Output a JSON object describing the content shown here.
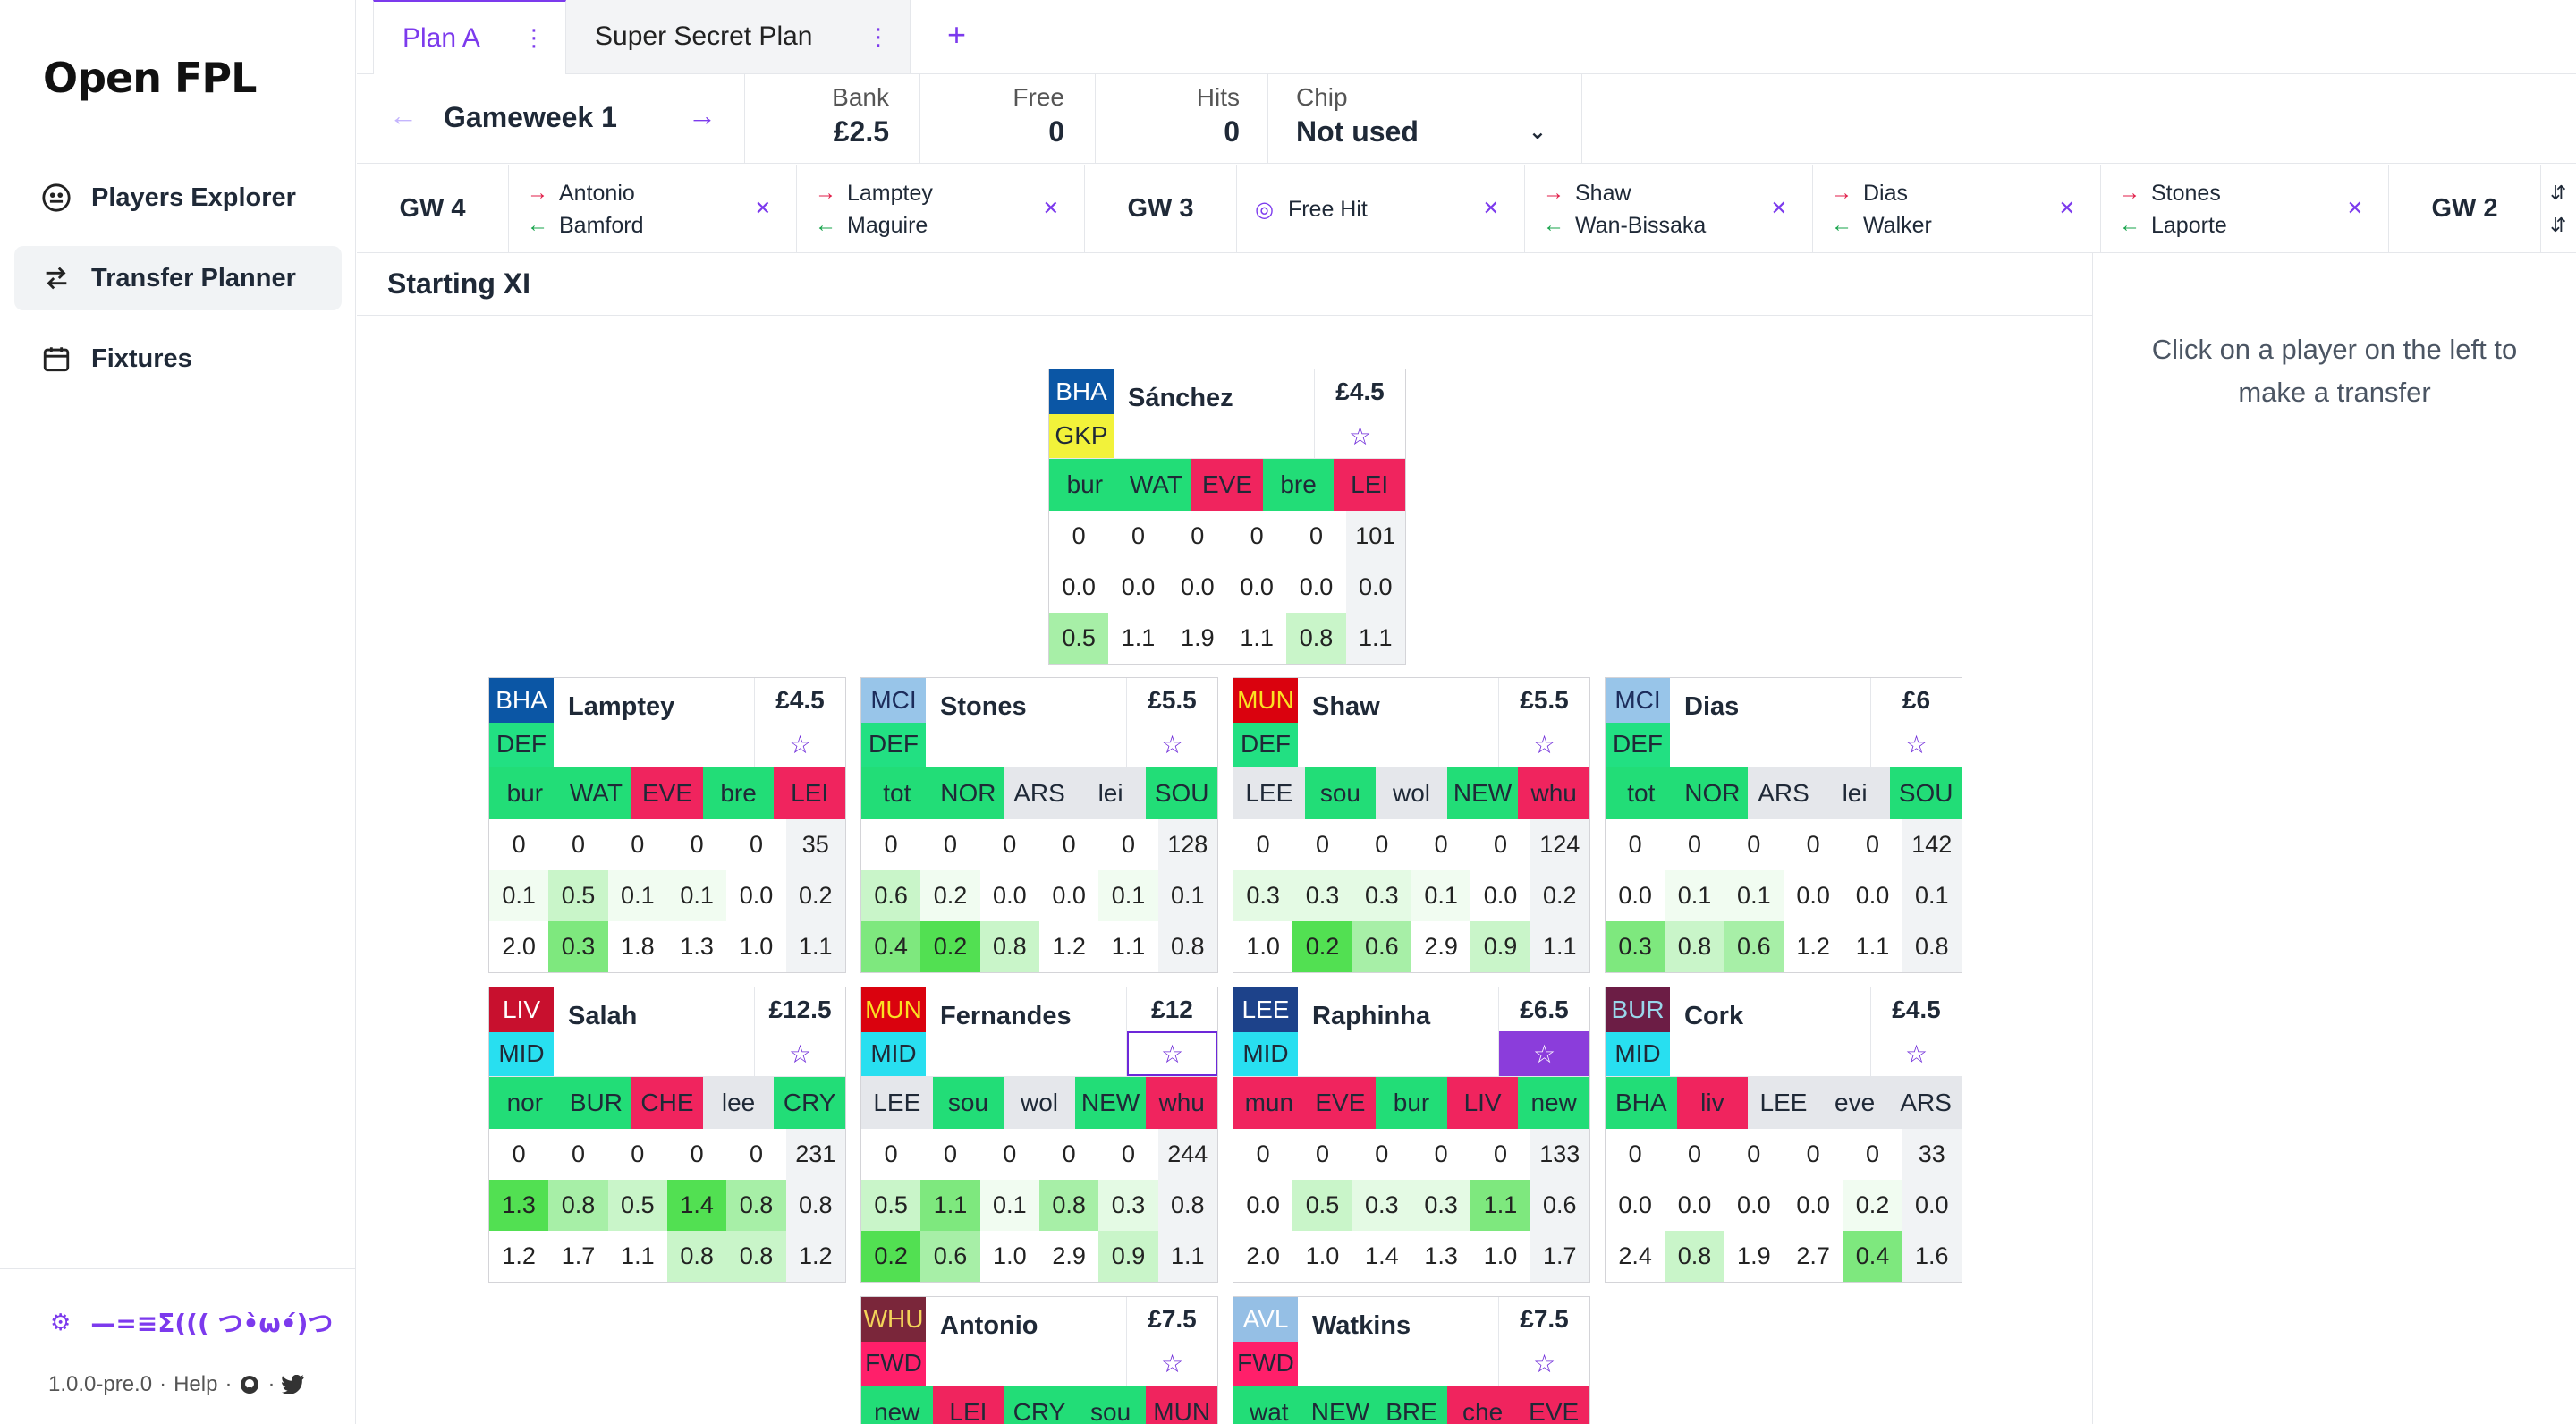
{
  "app": {
    "title": "Open FPL",
    "version": "1.0.0-pre.0",
    "help": "Help",
    "tagline": "—=≡Σ((( つ•̀ω•́)つ"
  },
  "nav": [
    {
      "label": "Players Explorer",
      "icon": "players-icon"
    },
    {
      "label": "Transfer Planner",
      "icon": "transfer-icon"
    },
    {
      "label": "Fixtures",
      "icon": "calendar-icon"
    }
  ],
  "tabs": [
    {
      "label": "Plan A"
    },
    {
      "label": "Super Secret Plan"
    }
  ],
  "stats": {
    "gameweek": "Gameweek 1",
    "bank_label": "Bank",
    "bank": "£2.5",
    "free_label": "Free",
    "free": "0",
    "hits_label": "Hits",
    "hits": "0",
    "chip_label": "Chip",
    "chip": "Not used"
  },
  "chain": {
    "gw4": "GW 4",
    "gw3": "GW 3",
    "gw2": "GW 2",
    "t1": {
      "out": "Antonio",
      "in": "Bamford"
    },
    "t2": {
      "out": "Lamptey",
      "in": "Maguire"
    },
    "freehit": "Free Hit",
    "t3": {
      "out": "Shaw",
      "in": "Wan-Bissaka"
    },
    "t4": {
      "out": "Dias",
      "in": "Walker"
    },
    "t5": {
      "out": "Stones",
      "in": "Laporte"
    }
  },
  "section": "Starting XI",
  "hint": "Click on a player on the left to make a transfer",
  "colors": {
    "accent": "#7c3aed",
    "green": "#22dd77",
    "red": "#f0245e",
    "grey": "#e5e7eb",
    "gkp": "#f2f23a",
    "def": "#22e082",
    "mid": "#28dff0",
    "fwd": "#ff1f6a"
  },
  "players": {
    "sanchez": {
      "team": "BHA",
      "pos": "GKP",
      "name": "Sánchez",
      "price": "£4.5",
      "star": "☆",
      "fix": [
        "bur",
        "WAT",
        "EVE",
        "bre",
        "LEI"
      ],
      "r1": [
        "0",
        "0",
        "0",
        "0",
        "0",
        "101"
      ],
      "r2": [
        "0.0",
        "0.0",
        "0.0",
        "0.0",
        "0.0",
        "0.0"
      ],
      "r3": [
        "0.5",
        "1.1",
        "1.9",
        "1.1",
        "0.8",
        "1.1"
      ]
    },
    "lamptey": {
      "team": "BHA",
      "pos": "DEF",
      "name": "Lamptey",
      "price": "£4.5",
      "star": "☆",
      "fix": [
        "bur",
        "WAT",
        "EVE",
        "bre",
        "LEI"
      ],
      "r1": [
        "0",
        "0",
        "0",
        "0",
        "0",
        "35"
      ],
      "r2": [
        "0.1",
        "0.5",
        "0.1",
        "0.1",
        "0.0",
        "0.2"
      ],
      "r3": [
        "2.0",
        "0.3",
        "1.8",
        "1.3",
        "1.0",
        "1.1"
      ]
    },
    "stones": {
      "team": "MCI",
      "pos": "DEF",
      "name": "Stones",
      "price": "£5.5",
      "star": "☆",
      "fix": [
        "tot",
        "NOR",
        "ARS",
        "lei",
        "SOU"
      ],
      "r1": [
        "0",
        "0",
        "0",
        "0",
        "0",
        "128"
      ],
      "r2": [
        "0.6",
        "0.2",
        "0.0",
        "0.0",
        "0.1",
        "0.1"
      ],
      "r3": [
        "0.4",
        "0.2",
        "0.8",
        "1.2",
        "1.1",
        "0.8"
      ]
    },
    "shaw": {
      "team": "MUN",
      "pos": "DEF",
      "name": "Shaw",
      "price": "£5.5",
      "star": "☆",
      "fix": [
        "LEE",
        "sou",
        "wol",
        "NEW",
        "whu"
      ],
      "r1": [
        "0",
        "0",
        "0",
        "0",
        "0",
        "124"
      ],
      "r2": [
        "0.3",
        "0.3",
        "0.3",
        "0.1",
        "0.0",
        "0.2"
      ],
      "r3": [
        "1.0",
        "0.2",
        "0.6",
        "2.9",
        "0.9",
        "1.1"
      ]
    },
    "dias": {
      "team": "MCI",
      "pos": "DEF",
      "name": "Dias",
      "price": "£6",
      "star": "☆",
      "fix": [
        "tot",
        "NOR",
        "ARS",
        "lei",
        "SOU"
      ],
      "r1": [
        "0",
        "0",
        "0",
        "0",
        "0",
        "142"
      ],
      "r2": [
        "0.0",
        "0.1",
        "0.1",
        "0.0",
        "0.0",
        "0.1"
      ],
      "r3": [
        "0.3",
        "0.8",
        "0.6",
        "1.2",
        "1.1",
        "0.8"
      ]
    },
    "salah": {
      "team": "LIV",
      "pos": "MID",
      "name": "Salah",
      "price": "£12.5",
      "star": "☆",
      "fix": [
        "nor",
        "BUR",
        "CHE",
        "lee",
        "CRY"
      ],
      "r1": [
        "0",
        "0",
        "0",
        "0",
        "0",
        "231"
      ],
      "r2": [
        "1.3",
        "0.8",
        "0.5",
        "1.4",
        "0.8",
        "0.8"
      ],
      "r3": [
        "1.2",
        "1.7",
        "1.1",
        "0.8",
        "0.8",
        "1.2"
      ]
    },
    "fernandes": {
      "team": "MUN",
      "pos": "MID",
      "name": "Fernandes",
      "price": "£12",
      "star": "☆",
      "fix": [
        "LEE",
        "sou",
        "wol",
        "NEW",
        "whu"
      ],
      "r1": [
        "0",
        "0",
        "0",
        "0",
        "0",
        "244"
      ],
      "r2": [
        "0.5",
        "1.1",
        "0.1",
        "0.8",
        "0.3",
        "0.8"
      ],
      "r3": [
        "0.2",
        "0.6",
        "1.0",
        "2.9",
        "0.9",
        "1.1"
      ]
    },
    "raphinha": {
      "team": "LEE",
      "pos": "MID",
      "name": "Raphinha",
      "price": "£6.5",
      "star": "☆",
      "fix": [
        "mun",
        "EVE",
        "bur",
        "LIV",
        "new"
      ],
      "r1": [
        "0",
        "0",
        "0",
        "0",
        "0",
        "133"
      ],
      "r2": [
        "0.0",
        "0.5",
        "0.3",
        "0.3",
        "1.1",
        "0.6"
      ],
      "r3": [
        "2.0",
        "1.0",
        "1.4",
        "1.3",
        "1.0",
        "1.7"
      ]
    },
    "cork": {
      "team": "BUR",
      "pos": "MID",
      "name": "Cork",
      "price": "£4.5",
      "star": "☆",
      "fix": [
        "BHA",
        "liv",
        "LEE",
        "eve",
        "ARS"
      ],
      "r1": [
        "0",
        "0",
        "0",
        "0",
        "0",
        "33"
      ],
      "r2": [
        "0.0",
        "0.0",
        "0.0",
        "0.0",
        "0.2",
        "0.0"
      ],
      "r3": [
        "2.4",
        "0.8",
        "1.9",
        "2.7",
        "0.4",
        "1.6"
      ]
    },
    "antonio": {
      "team": "WHU",
      "pos": "FWD",
      "name": "Antonio",
      "price": "£7.5",
      "star": "☆",
      "fix": [
        "new",
        "LEI",
        "CRY",
        "sou",
        "MUN"
      ]
    },
    "watkins": {
      "team": "AVL",
      "pos": "FWD",
      "name": "Watkins",
      "price": "£7.5",
      "star": "☆",
      "fix": [
        "wat",
        "NEW",
        "BRE",
        "che",
        "EVE"
      ]
    }
  }
}
